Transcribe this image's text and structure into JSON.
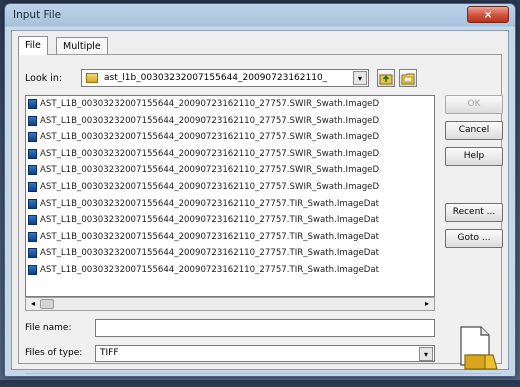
{
  "window": {
    "title": "Input File",
    "close_glyph": "×"
  },
  "tabs": [
    {
      "label": "File",
      "active": true
    },
    {
      "label": "Multiple",
      "active": false
    }
  ],
  "look_in": {
    "label": "Look in:",
    "value": "ast_l1b_00303232007155644_20090723162110_",
    "arrow_glyph": "▾"
  },
  "files": [
    "AST_L1B_00303232007155644_20090723162110_27757.SWIR_Swath.ImageD",
    "AST_L1B_00303232007155644_20090723162110_27757.SWIR_Swath.ImageD",
    "AST_L1B_00303232007155644_20090723162110_27757.SWIR_Swath.ImageD",
    "AST_L1B_00303232007155644_20090723162110_27757.SWIR_Swath.ImageD",
    "AST_L1B_00303232007155644_20090723162110_27757.SWIR_Swath.ImageD",
    "AST_L1B_00303232007155644_20090723162110_27757.SWIR_Swath.ImageD",
    "AST_L1B_00303232007155644_20090723162110_27757.TIR_Swath.ImageDat",
    "AST_L1B_00303232007155644_20090723162110_27757.TIR_Swath.ImageDat",
    "AST_L1B_00303232007155644_20090723162110_27757.TIR_Swath.ImageDat",
    "AST_L1B_00303232007155644_20090723162110_27757.TIR_Swath.ImageDat",
    "AST_L1B_00303232007155644_20090723162110_27757.TIR_Swath.ImageDat"
  ],
  "scrollbar": {
    "left_glyph": "◂",
    "right_glyph": "▸"
  },
  "buttons": {
    "ok": "OK",
    "cancel": "Cancel",
    "help": "Help",
    "recent": "Recent ...",
    "goto": "Goto ..."
  },
  "file_name": {
    "label": "File name:",
    "value": ""
  },
  "files_of_type": {
    "label": "Files of type:",
    "value": "TIFF",
    "arrow_glyph": "▾"
  },
  "icons": {
    "folder": "folder-icon",
    "up_folder": "up-folder-icon",
    "new_folder": "new-folder-icon",
    "file": "image-file-icon",
    "preview": "file-open-icon"
  },
  "colors": {
    "title_gradient_top": "#bcd3ea",
    "close_red": "#d2553f",
    "file_icon_blue": "#1e5aa8"
  }
}
